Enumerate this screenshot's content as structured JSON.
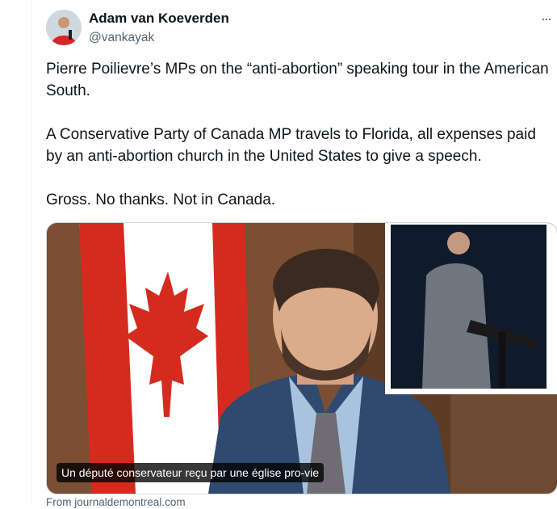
{
  "tweet": {
    "author_name": "Adam van Koeverden",
    "author_handle": "@vankayak",
    "more_icon": "more-horizontal-icon",
    "text": "Pierre Poilievre’s MPs on the “anti-abortion” speaking tour in the American South.\n\nA Conservative Party of Canada MP travels to Florida, all expenses paid by an anti-abortion church in the United States to give a speech.\n\nGross. No thanks. Not in Canada."
  },
  "card": {
    "caption": "Un député conservateur reçu par une église pro-vie",
    "source": "From journaldemontreal.com"
  }
}
